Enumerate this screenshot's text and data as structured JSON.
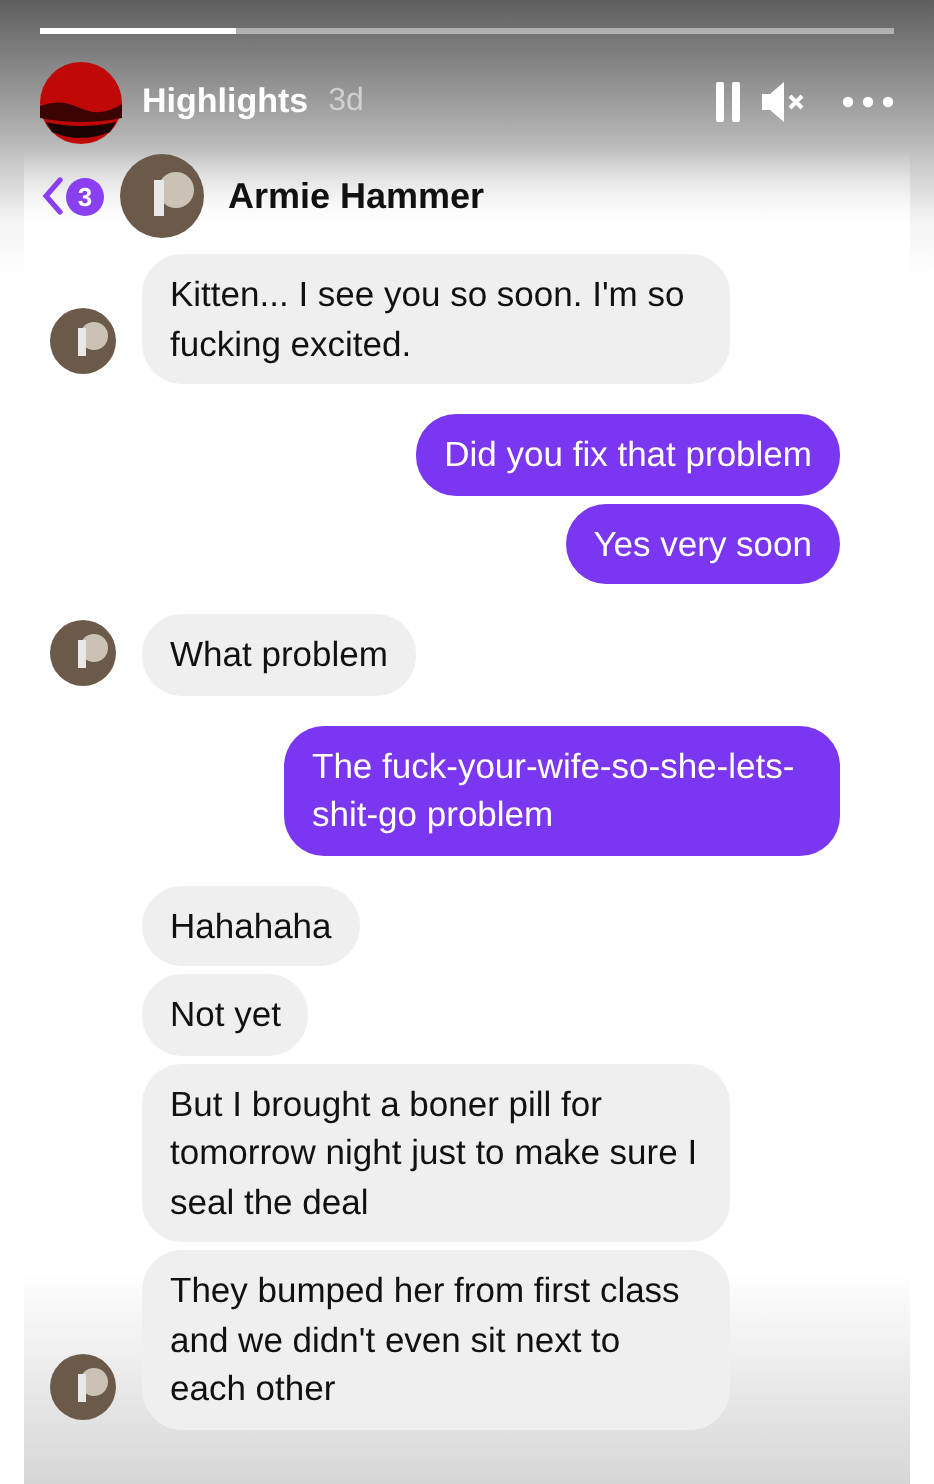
{
  "story": {
    "title": "Highlights",
    "age": "3d",
    "paused": true,
    "muted": true,
    "level": 0.23
  },
  "chat": {
    "unread_count": "3",
    "contact": "Armie Hammer"
  },
  "groups": [
    {
      "kind": "incoming",
      "messages": [
        "Kitten... I see you so soon. I'm so fucking excited."
      ]
    },
    {
      "kind": "outgoing",
      "messages": [
        "Did you fix that problem",
        "Yes very soon"
      ]
    },
    {
      "kind": "incoming",
      "messages": [
        "What problem"
      ]
    },
    {
      "kind": "outgoing",
      "messages": [
        "The fuck-your-wife-so-she-lets-shit-go problem"
      ]
    },
    {
      "kind": "incoming",
      "messages": [
        "Hahahaha",
        "Not yet",
        "But I brought a boner pill for tomorrow night just to make sure I seal the deal",
        "They bumped her from first class and we didn't even sit next to each other"
      ]
    }
  ]
}
